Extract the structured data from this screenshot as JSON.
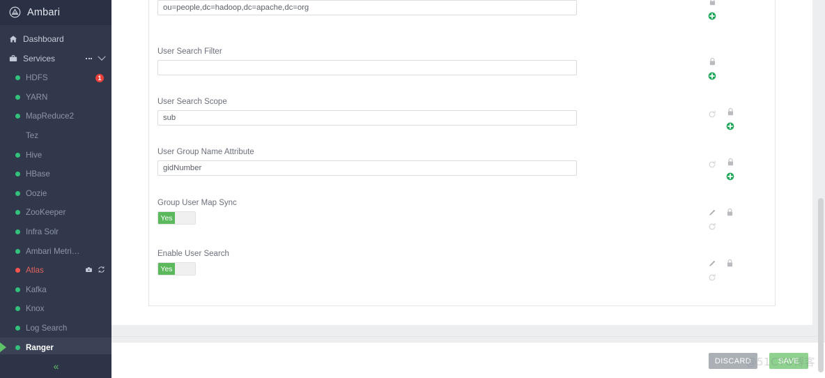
{
  "brand": {
    "name": "Ambari",
    "logo_icon": "ambari-logo-icon"
  },
  "sidebar": {
    "dashboard": {
      "label": "Dashboard",
      "icon": "home-icon"
    },
    "services": {
      "label": "Services",
      "icon": "briefcase-icon",
      "menu_icon": "ellipsis-icon",
      "collapse_icon": "chevron-down-icon"
    },
    "collapse_label": "«",
    "items": [
      {
        "label": "HDFS",
        "status": "green",
        "badge": "1"
      },
      {
        "label": "YARN",
        "status": "green"
      },
      {
        "label": "MapReduce2",
        "status": "green"
      },
      {
        "label": "Tez",
        "status": "none"
      },
      {
        "label": "Hive",
        "status": "green"
      },
      {
        "label": "HBase",
        "status": "green"
      },
      {
        "label": "Oozie",
        "status": "green"
      },
      {
        "label": "ZooKeeper",
        "status": "green"
      },
      {
        "label": "Infra Solr",
        "status": "green"
      },
      {
        "label": "Ambari Metri…",
        "status": "green"
      },
      {
        "label": "Atlas",
        "status": "red",
        "alert": true,
        "icons": [
          "maintenance-icon",
          "restart-icon"
        ]
      },
      {
        "label": "Kafka",
        "status": "green"
      },
      {
        "label": "Knox",
        "status": "green"
      },
      {
        "label": "Log Search",
        "status": "green"
      },
      {
        "label": "Ranger",
        "status": "green",
        "active": true
      }
    ]
  },
  "config": {
    "fields": [
      {
        "label": "",
        "value": "ou=people,dc=hadoop,dc=apache,dc=org",
        "type": "text",
        "name": "user-search-base",
        "icons": [
          "lock-icon",
          "override-add-icon"
        ]
      },
      {
        "label": "User Search Filter",
        "value": "",
        "type": "text",
        "name": "user-search-filter",
        "icons": [
          "lock-icon",
          "override-add-icon"
        ]
      },
      {
        "label": "User Search Scope",
        "value": "sub",
        "type": "text",
        "name": "user-search-scope",
        "icons": [
          "revert-icon",
          "lock-icon",
          "override-add-icon"
        ]
      },
      {
        "label": "User Group Name Attribute",
        "value": "gidNumber",
        "type": "text",
        "name": "user-group-name-attribute",
        "icons": [
          "revert-icon",
          "lock-icon",
          "override-add-icon"
        ]
      },
      {
        "label": "Group User Map Sync",
        "value": "Yes",
        "type": "toggle",
        "name": "group-user-map-sync",
        "icons": [
          "edit-pencil-icon",
          "lock-icon",
          "revert-icon"
        ]
      },
      {
        "label": "Enable User Search",
        "value": "Yes",
        "type": "toggle",
        "name": "enable-user-search",
        "icons": [
          "edit-pencil-icon",
          "lock-icon",
          "revert-icon"
        ]
      }
    ]
  },
  "footer": {
    "discard_label": "DISCARD",
    "save_label": "SAVE"
  },
  "watermark": {
    "text": "@51CTO博客"
  },
  "colors": {
    "sidebar_bg": "#32384b",
    "sidebar_header_bg": "#2b3144",
    "active_row_bg": "#3b4256",
    "status_green": "#32c07a",
    "status_red": "#f8544f",
    "badge_red": "#e8413c",
    "toggle_on_green": "#5cb85c",
    "save_green": "#8fd28f",
    "discard_grey": "#aab0b6",
    "marker_green": "#5fc36a"
  }
}
